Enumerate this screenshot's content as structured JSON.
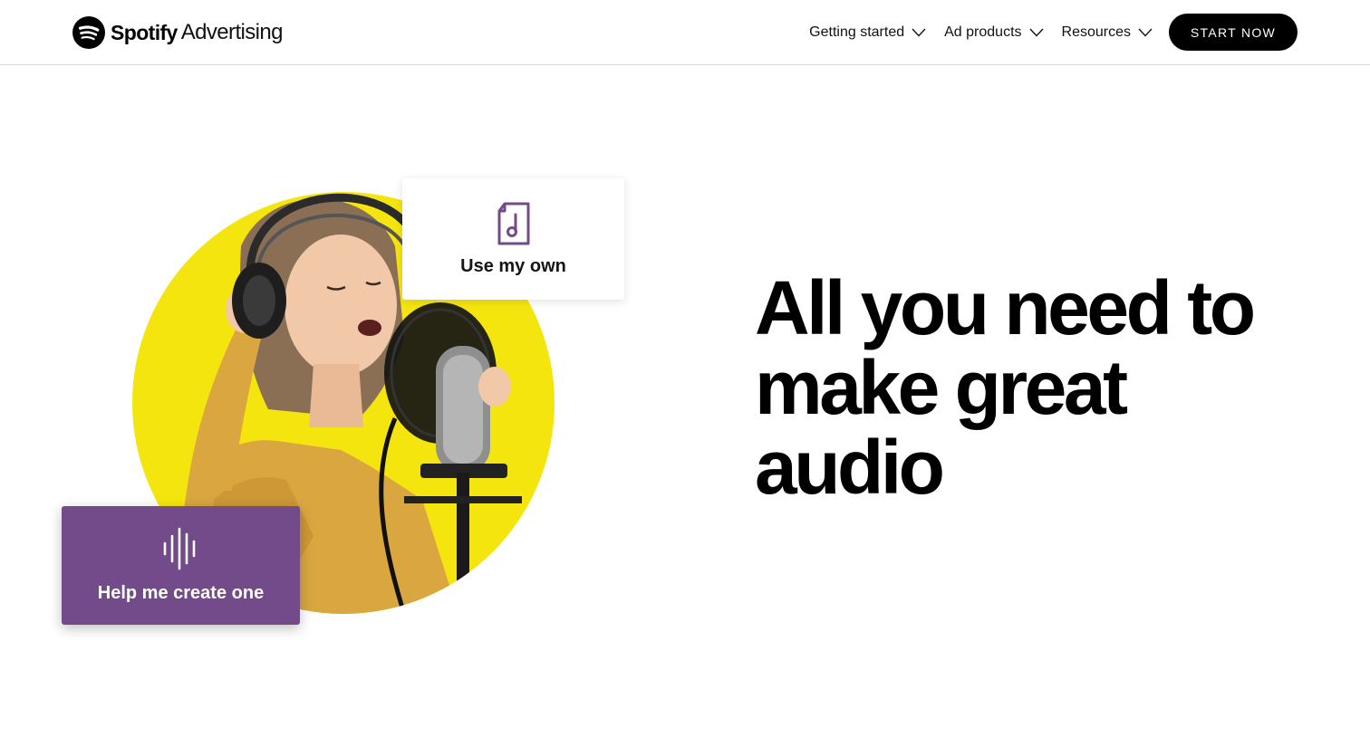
{
  "header": {
    "brand": "Spotify",
    "product": "Advertising",
    "nav": [
      {
        "label": "Getting started"
      },
      {
        "label": "Ad products"
      },
      {
        "label": "Resources"
      }
    ],
    "cta_label": "START NOW"
  },
  "hero": {
    "headline": "All you need to make great audio",
    "cards": {
      "own": {
        "label": "Use my own",
        "icon": "music-file-icon"
      },
      "create": {
        "label": "Help me create one",
        "icon": "sound-wave-icon"
      }
    },
    "image": {
      "subject": "singer-with-headphones-and-microphone"
    }
  },
  "colors": {
    "accent_yellow": "#f5e50f",
    "accent_purple": "#734a8a",
    "cta_bg": "#000000",
    "text": "#000000"
  }
}
